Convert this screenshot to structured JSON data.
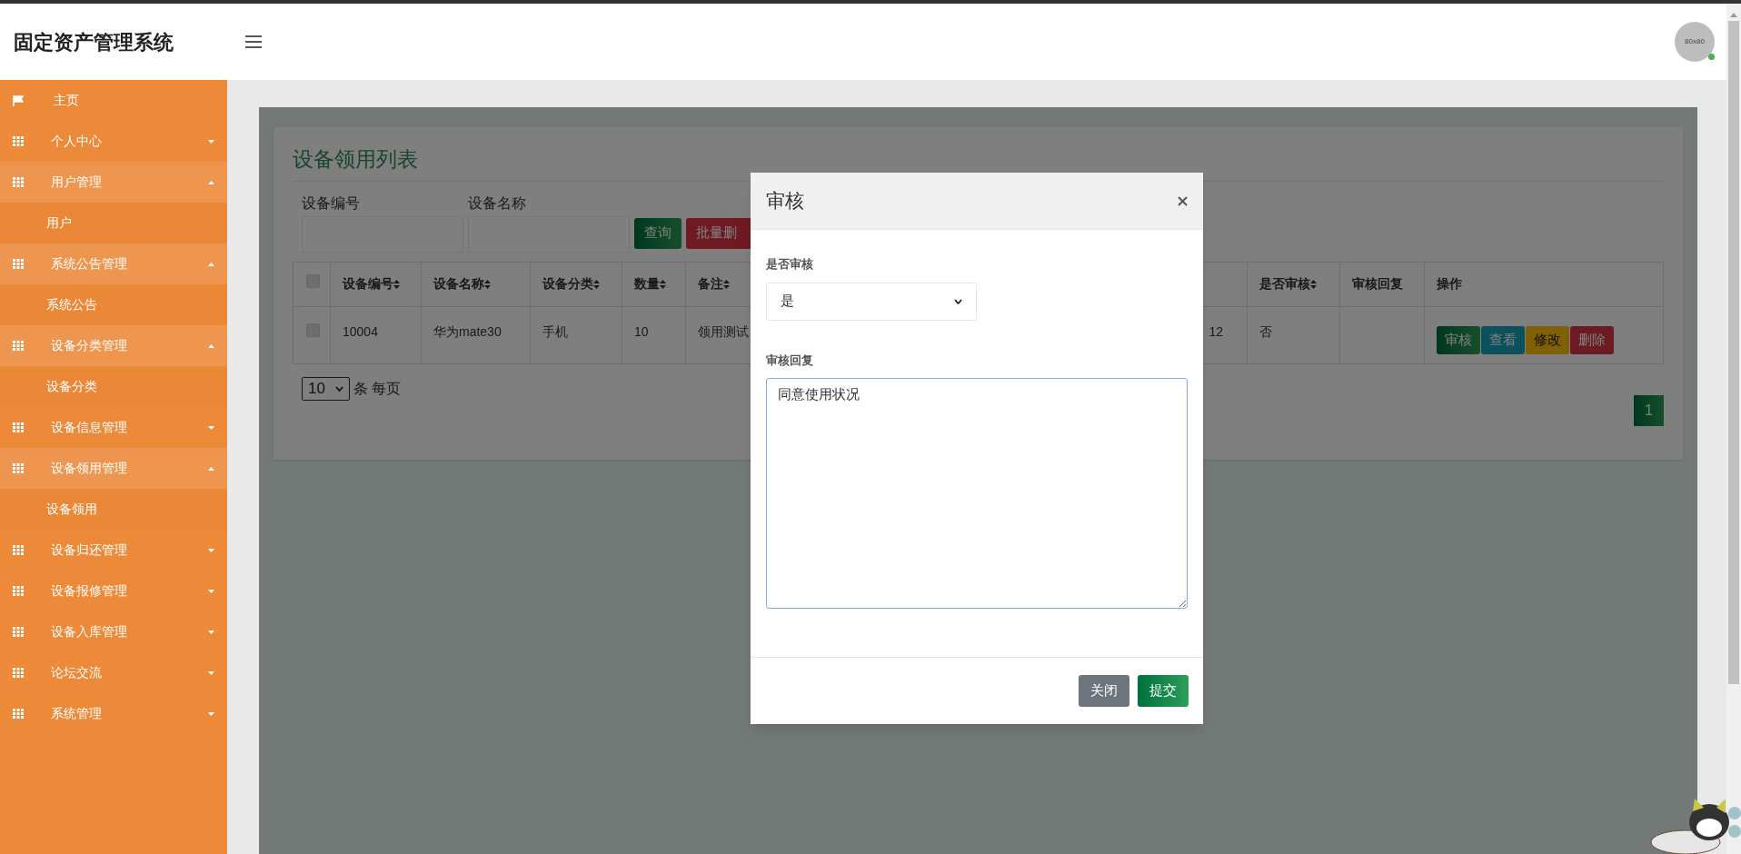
{
  "app": {
    "title": "固定资产管理系统"
  },
  "user": {
    "avatar_label": "80x80",
    "online": true
  },
  "sidebar": {
    "items": [
      {
        "kind": "home",
        "label": "主页"
      },
      {
        "kind": "group",
        "label": "个人中心",
        "expanded": false
      },
      {
        "kind": "group",
        "label": "用户管理",
        "expanded": true,
        "children": [
          {
            "label": "用户"
          }
        ]
      },
      {
        "kind": "group",
        "label": "系统公告管理",
        "expanded": true,
        "children": [
          {
            "label": "系统公告"
          }
        ]
      },
      {
        "kind": "group",
        "label": "设备分类管理",
        "expanded": true,
        "children": [
          {
            "label": "设备分类"
          }
        ]
      },
      {
        "kind": "group",
        "label": "设备信息管理",
        "expanded": false
      },
      {
        "kind": "group",
        "label": "设备领用管理",
        "expanded": true,
        "children": [
          {
            "label": "设备领用"
          }
        ]
      },
      {
        "kind": "group",
        "label": "设备归还管理",
        "expanded": false
      },
      {
        "kind": "group",
        "label": "设备报修管理",
        "expanded": false
      },
      {
        "kind": "group",
        "label": "设备入库管理",
        "expanded": false
      },
      {
        "kind": "group",
        "label": "论坛交流",
        "expanded": false
      },
      {
        "kind": "group",
        "label": "系统管理",
        "expanded": false
      }
    ]
  },
  "page": {
    "title": "设备领用列表",
    "filters": [
      {
        "label": "设备编号"
      },
      {
        "label": "设备名称"
      }
    ],
    "buttons": [
      {
        "label": "查询",
        "kind": "success"
      },
      {
        "label": "批量删",
        "kind": "danger"
      }
    ],
    "table": {
      "select_all_checked": false,
      "columns": [
        {
          "header": "设备编号",
          "sortable": true
        },
        {
          "header": "设备名称",
          "sortable": true
        },
        {
          "header": "设备分类",
          "sortable": true
        },
        {
          "header": "数量",
          "sortable": true
        },
        {
          "header": "备注",
          "sortable": true
        },
        {
          "kind": "hidden"
        },
        {
          "header": "是否审核",
          "sortable": true
        },
        {
          "header": "审核回复",
          "sortable": false
        },
        {
          "header": "操作",
          "sortable": false,
          "kind": "actions"
        }
      ],
      "rows": [
        {
          "checked": false,
          "cells": [
            "10004",
            "华为mate30",
            "手机",
            "10",
            "领用测试",
            "12",
            "否"
          ],
          "actions": [
            {
              "label": "审核",
              "kind": "success"
            },
            {
              "label": "查看",
              "kind": "info"
            },
            {
              "label": "修改",
              "kind": "warning"
            },
            {
              "label": "删除",
              "kind": "danger"
            }
          ]
        }
      ]
    },
    "page_size": {
      "value": "10",
      "suffix": "条 每页"
    },
    "pages": [
      {
        "label": "1",
        "selected": true
      }
    ]
  },
  "modal": {
    "title": "审核",
    "fields": [
      {
        "kind": "select",
        "label": "是否审核",
        "value": "是"
      },
      {
        "kind": "textarea",
        "label": "审核回复",
        "value": "同意使用状况"
      }
    ],
    "buttons": [
      {
        "label": "关闭",
        "kind": "secondary"
      },
      {
        "label": "提交",
        "kind": "success"
      }
    ]
  }
}
